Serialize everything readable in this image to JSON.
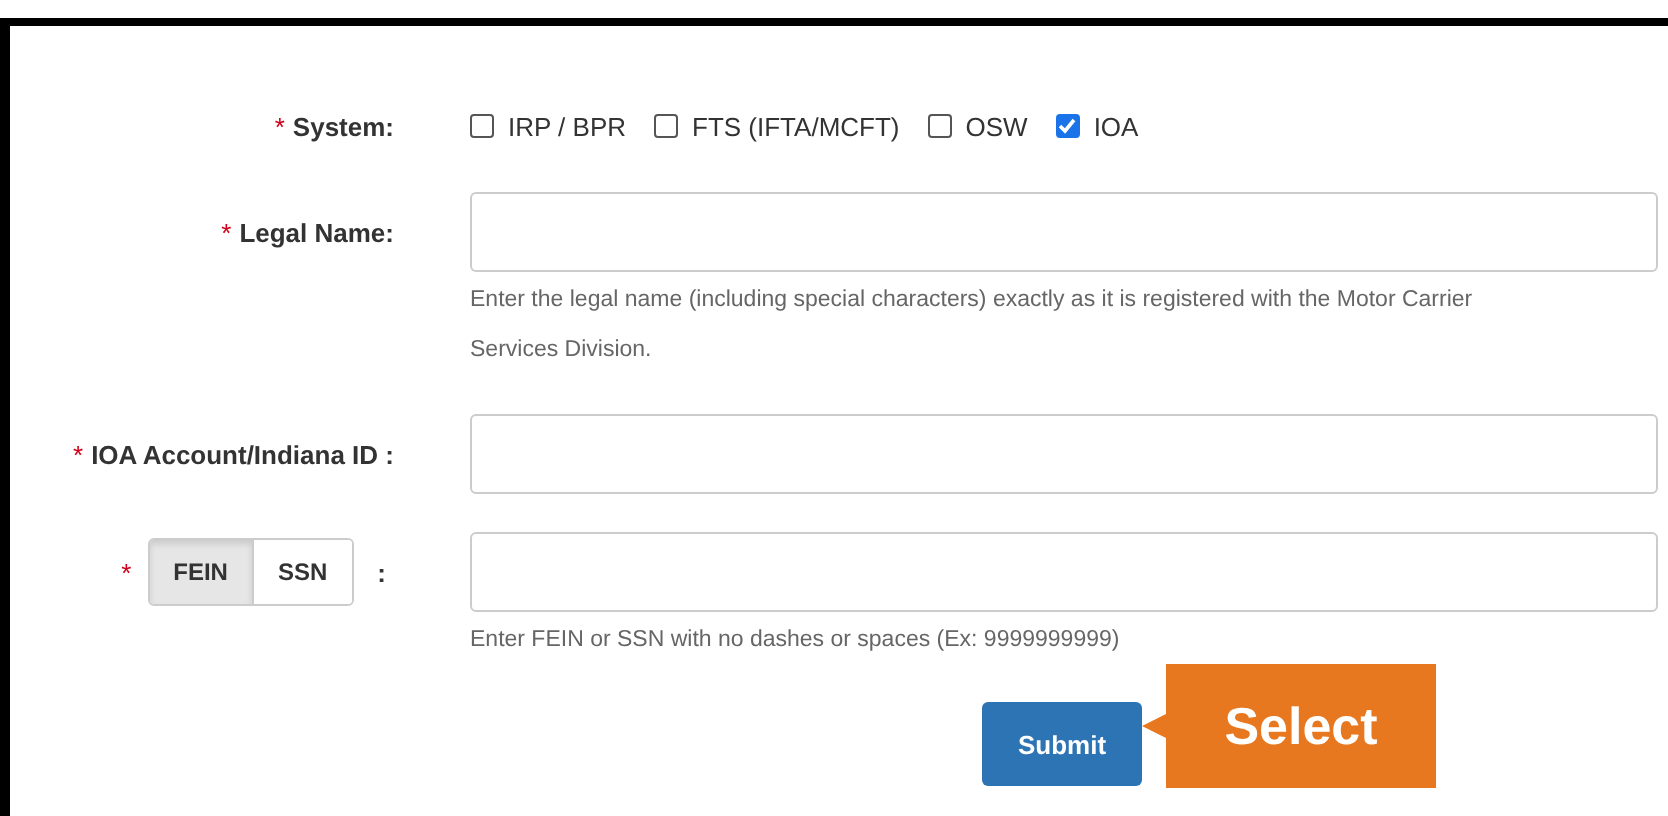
{
  "fields": [
    {
      "kind": "checks",
      "marker": "*",
      "label": "System:",
      "options": [
        {
          "label": "IRP / BPR",
          "checked": false
        },
        {
          "label": "FTS (IFTA/MCFT)",
          "checked": false
        },
        {
          "label": "OSW",
          "checked": false
        },
        {
          "label": "IOA",
          "checked": true
        }
      ]
    },
    {
      "kind": "text",
      "marker": "*",
      "label": "Legal Name:",
      "help": "Enter the legal name (including special characters) exactly as it is registered with the Motor Carrier Services Division."
    },
    {
      "kind": "text",
      "marker": "*",
      "label": "IOA Account/Indiana ID :"
    },
    {
      "kind": "toggle",
      "marker": "*",
      "options": [
        {
          "label": "FEIN",
          "selected": true
        },
        {
          "label": "SSN",
          "selected": false
        }
      ],
      "suffix": ":",
      "help": "Enter FEIN or SSN with no dashes or spaces (Ex: 9999999999)"
    }
  ],
  "submit": "Submit",
  "callout": "Select"
}
